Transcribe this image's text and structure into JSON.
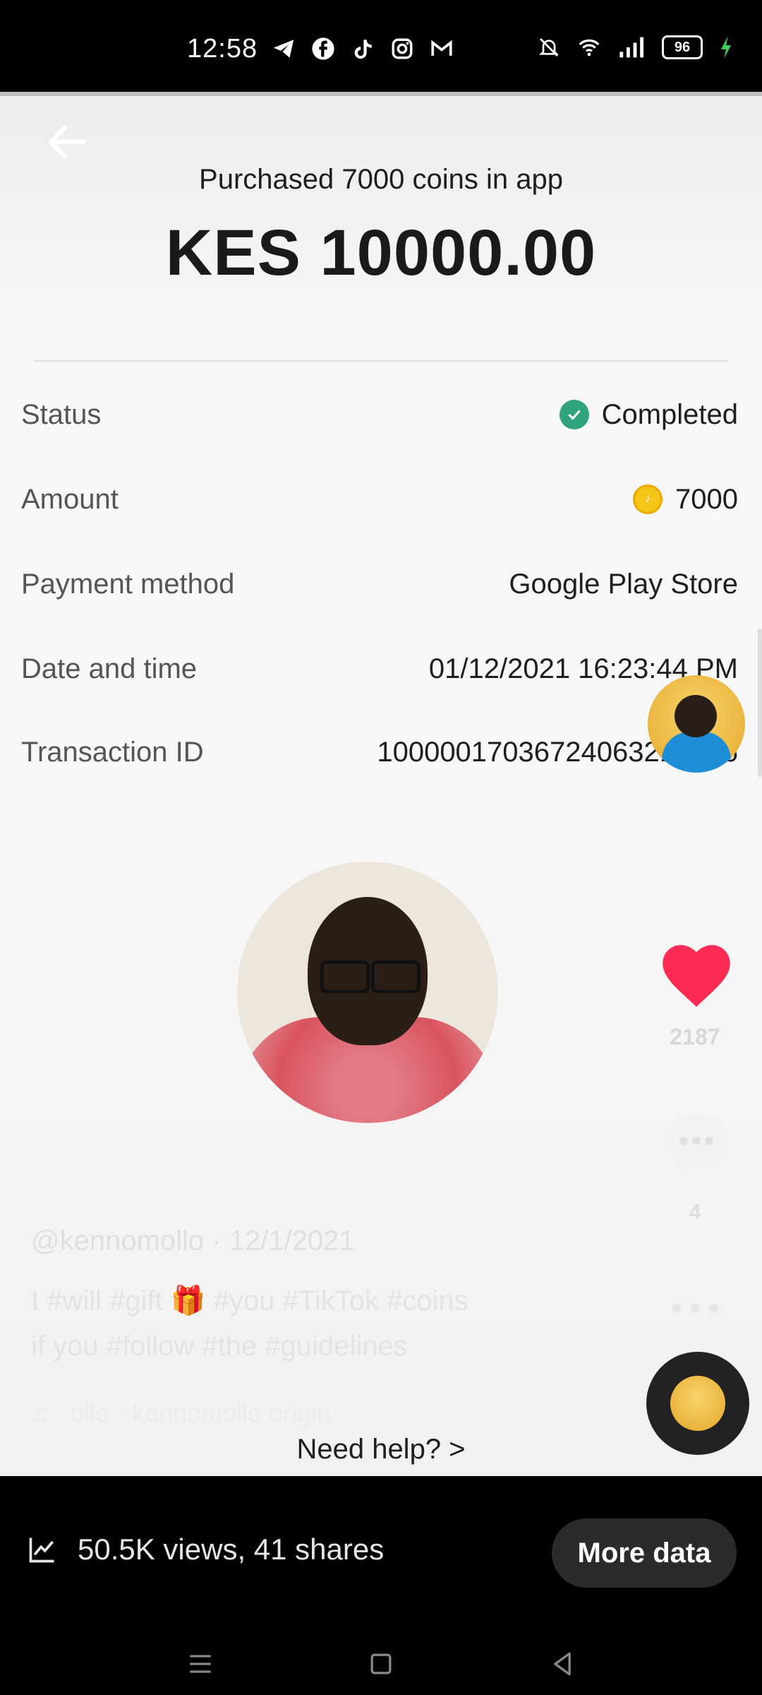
{
  "status_bar": {
    "time": "12:58",
    "battery": "96"
  },
  "purchase": {
    "subtitle": "Purchased 7000 coins in app",
    "amount": "KES 10000.00"
  },
  "details": {
    "status": {
      "label": "Status",
      "value": "Completed"
    },
    "amount": {
      "label": "Amount",
      "value": "7000"
    },
    "payment": {
      "label": "Payment method",
      "value": "Google Play Store"
    },
    "date": {
      "label": "Date and time",
      "value": "01/12/2021 16:23:44 PM"
    },
    "txn": {
      "label": "Transaction ID",
      "value": "10000017036724063217666"
    }
  },
  "video": {
    "likes": "2187",
    "comments": "4",
    "username": "@kennomollo · 12/1/2021",
    "caption_line1": "I #will #gift 🎁 #you #TikTok #coins",
    "caption_line2": "if you #follow #the #guidelines",
    "music": "ollo - kennomollo    origin"
  },
  "help": "Need help? >",
  "footer": {
    "stats": "50.5K views, 41 shares",
    "more_button": "More data"
  }
}
